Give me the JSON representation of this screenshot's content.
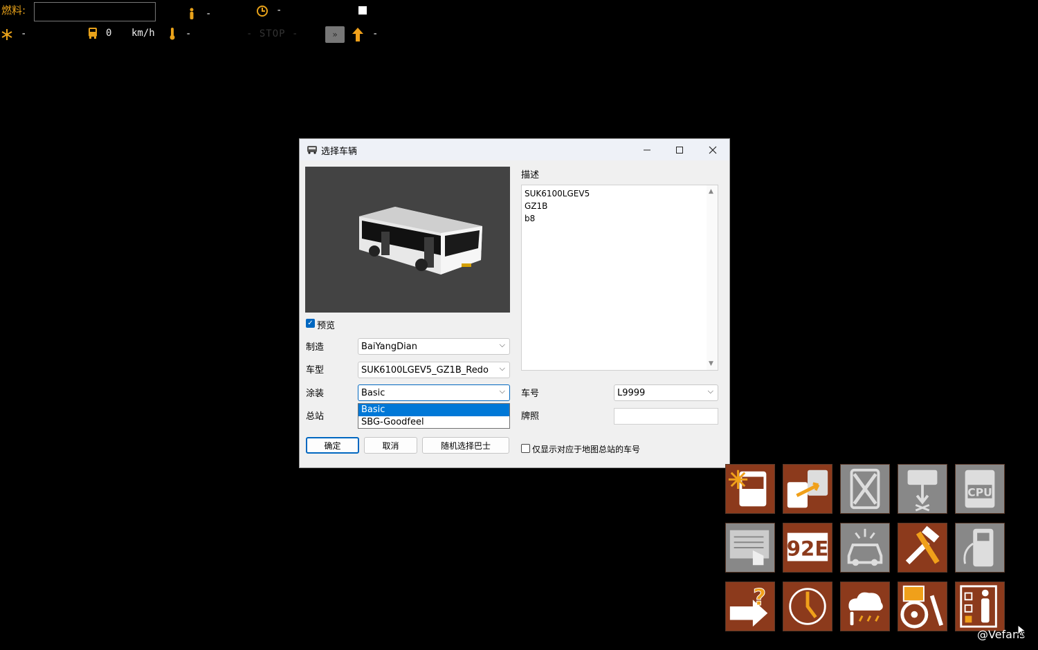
{
  "hud": {
    "fuel_label": "燃料:",
    "speed_value": "0",
    "speed_unit": "km/h",
    "stop_text": "- STOP -",
    "dash": "-",
    "forward_symbol": "»"
  },
  "dialog": {
    "title": "选择车辆",
    "preview_checkbox_label": "预览",
    "preview_checked": true,
    "labels": {
      "manufacturer": "制造",
      "model": "车型",
      "livery": "涂装",
      "depot": "总站",
      "description": "描述",
      "fleet_number": "车号",
      "plate": "牌照"
    },
    "manufacturer_value": "BaiYangDian",
    "model_value": "SUK6100LGEV5_GZ1B_Redo",
    "livery_value": "Basic",
    "livery_options": [
      "Basic",
      "SBG-Goodfeel"
    ],
    "fleet_number_value": "L9999",
    "plate_value": "",
    "description_lines": [
      "SUK6100LGEV5",
      "GZ1B",
      "b8"
    ],
    "buttons": {
      "ok": "确定",
      "cancel": "取消",
      "random": "随机选择巴士"
    },
    "filter_checkbox_label": "仅显示对应于地图总站的车号",
    "filter_checked": false
  },
  "tools": [
    {
      "name": "bus-repair-icon",
      "style": "brown"
    },
    {
      "name": "bus-swap-icon",
      "style": "brown"
    },
    {
      "name": "remove-bus-icon",
      "style": "gray"
    },
    {
      "name": "bus-lift-icon",
      "style": "gray"
    },
    {
      "name": "cpu-bus-icon",
      "style": "gray",
      "text": "CPU"
    },
    {
      "name": "timetable-icon",
      "style": "gray"
    },
    {
      "name": "route-display-icon",
      "style": "brown",
      "text": "92E"
    },
    {
      "name": "traffic-icon",
      "style": "gray"
    },
    {
      "name": "tools-icon",
      "style": "brown"
    },
    {
      "name": "fuel-icon",
      "style": "gray"
    },
    {
      "name": "help-icon",
      "style": "brown"
    },
    {
      "name": "clock-icon",
      "style": "brown"
    },
    {
      "name": "weather-icon",
      "style": "brown"
    },
    {
      "name": "driver-settings-icon",
      "style": "brown"
    },
    {
      "name": "passenger-checklist-icon",
      "style": "brown"
    }
  ],
  "watermark": "@Vefans"
}
